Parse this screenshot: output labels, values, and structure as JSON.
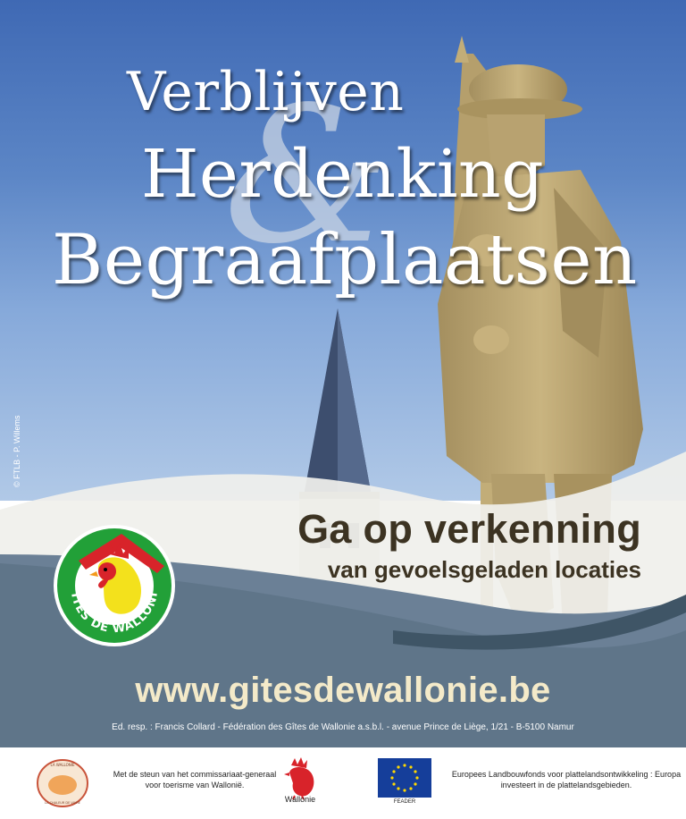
{
  "poster": {
    "title_line1": "Verblijven",
    "ampersand": "&",
    "title_line2": "Herdenking",
    "title_line3": "Begraafplaatsen",
    "photo_credit": "© FTLB - P. Willems",
    "tagline_main": "Ga op verkenning",
    "tagline_sub": "van gevoelsgeladen locaties",
    "website": "www.gitesdewallonie.be",
    "editor": "Ed. resp. : Francis Collard - Fédération des Gîtes de Wallonie a.s.b.l. - avenue Prince de Liège, 1/21 - B-5100 Namur"
  },
  "logo": {
    "text": "GITES DE WALLONIE",
    "icon": "rooster-icon",
    "ring_color": "#22a038",
    "roof_color": "#d8232a"
  },
  "footer": {
    "ftlb_text_top": "LA WALLONIE",
    "ftlb_text_bottom": "LA CHALEUR DE VIVRE",
    "support_text": "Met de steun van het commissariaat-generaal voor toerisme van Wallonië.",
    "wallonie_label": "Wallonie",
    "eu_label": "FEADER",
    "eafrd_text": "Europees Landbouwfonds voor plattelandsontwikkeling : Europa investeert in de plattelandsgebieden."
  },
  "colors": {
    "sky_top": "#3f69b4",
    "band_dark": "#5f7589",
    "text_brown": "#3c3322",
    "website_cream": "#f4eac9"
  }
}
